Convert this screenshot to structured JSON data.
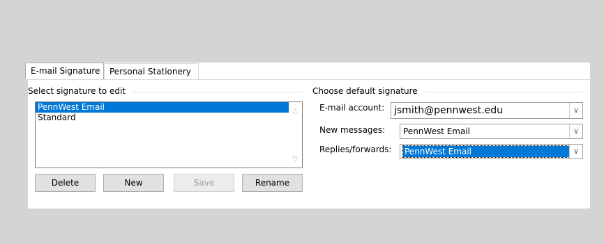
{
  "tabs": [
    {
      "label": "E-mail Signature"
    },
    {
      "label": "Personal Stationery"
    }
  ],
  "select_group": {
    "label": "Select signature to edit",
    "items": [
      "PennWest Email",
      "Standard"
    ]
  },
  "buttons": {
    "delete": "Delete",
    "new": "New",
    "save": "Save",
    "rename": "Rename"
  },
  "default_group": {
    "label": "Choose default signature",
    "email_account_label": "E-mail account:",
    "email_account_value": "jsmith@pennwest.edu",
    "new_messages_label": "New messages:",
    "new_messages_value": "PennWest Email",
    "replies_label": "Replies/forwards:",
    "replies_value": "PennWest Email"
  },
  "colors": {
    "selection": "#0078d7",
    "background": "#d4d4d4"
  }
}
